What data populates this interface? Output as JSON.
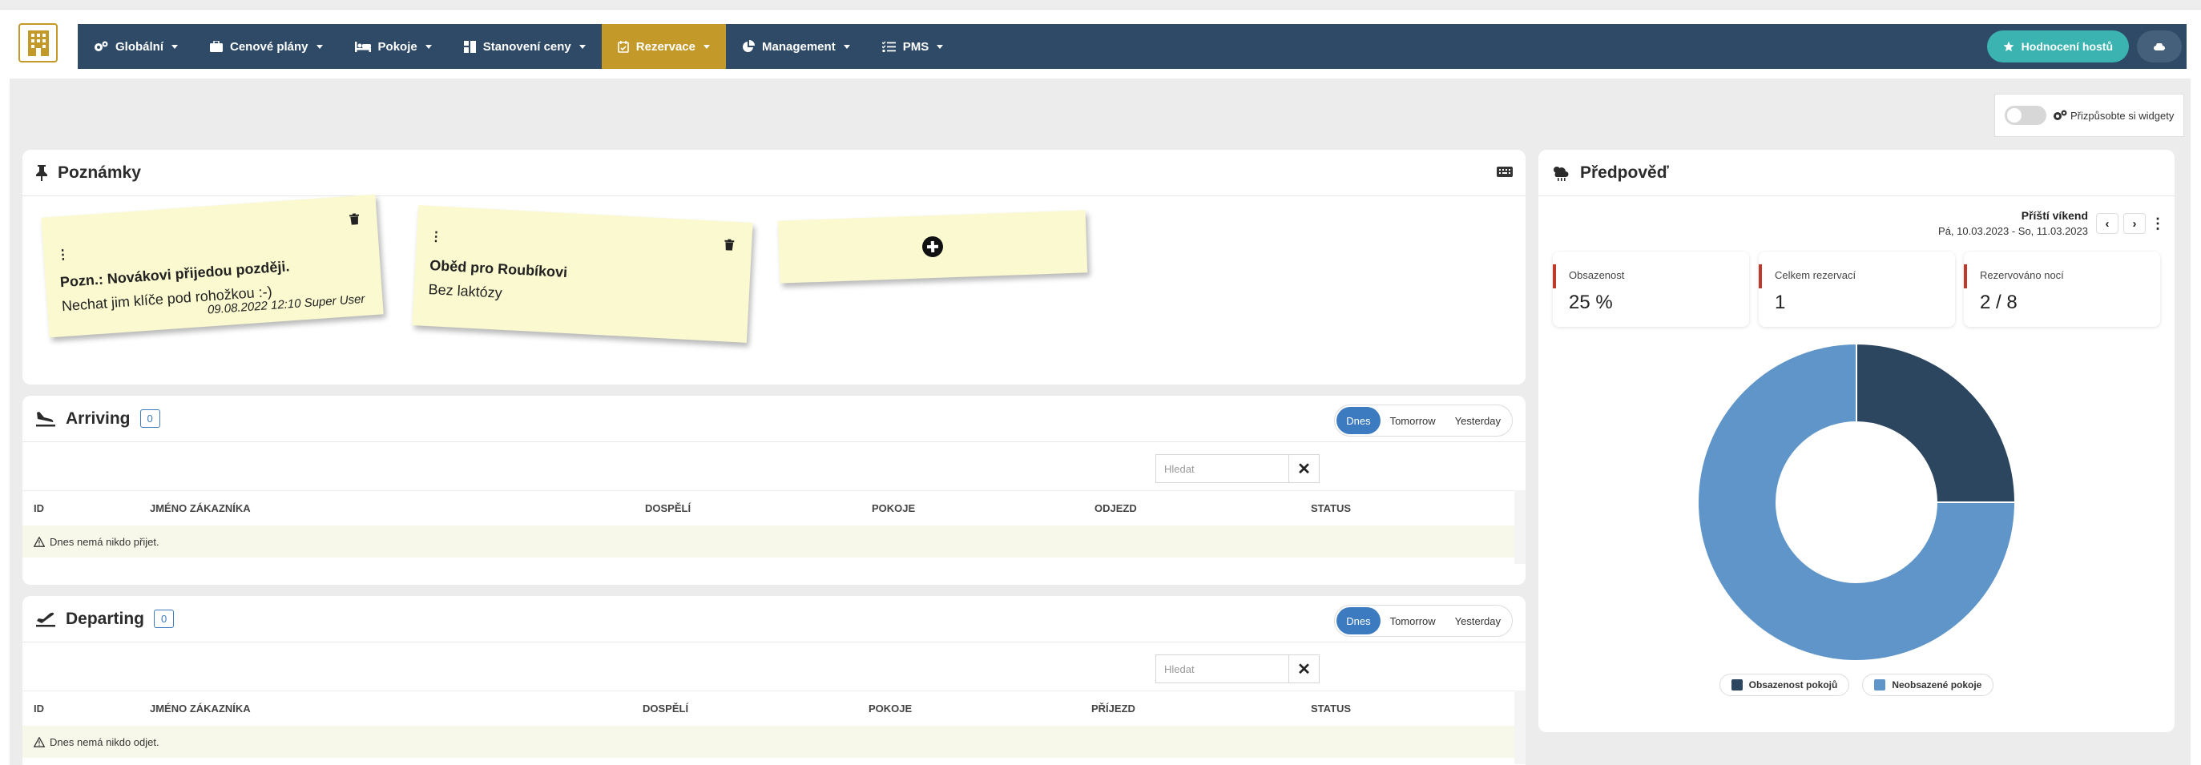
{
  "nav": {
    "items": [
      {
        "label": "Globální"
      },
      {
        "label": "Cenové plány"
      },
      {
        "label": "Pokoje"
      },
      {
        "label": "Stanovení ceny"
      },
      {
        "label": "Rezervace"
      },
      {
        "label": "Management"
      },
      {
        "label": "PMS"
      }
    ],
    "active_index": 4,
    "rating_label": "Hodnocení hostů"
  },
  "customize": {
    "label": "Přizpůsobte si widgety"
  },
  "notes": {
    "title": "Poznámky",
    "items": [
      {
        "line1": "Pozn.: Novákovi přijedou později.",
        "line2": "Nechat jim klíče pod rohožkou :-)",
        "signature": "09.08.2022 12:10 Super User"
      },
      {
        "line1": "Oběd pro Roubíkovi",
        "line2": "Bez laktózy"
      }
    ]
  },
  "arriving": {
    "title": "Arriving",
    "count": "0",
    "tabs": [
      "Dnes",
      "Tomorrow",
      "Yesterday"
    ],
    "search_placeholder": "Hledat",
    "columns": [
      "ID",
      "JMÉNO ZÁKAZNÍKA",
      "DOSPĚLÍ",
      "POKOJE",
      "ODJEZD",
      "STATUS"
    ],
    "empty": "Dnes nemá nikdo přijet."
  },
  "departing": {
    "title": "Departing",
    "count": "0",
    "tabs": [
      "Dnes",
      "Tomorrow",
      "Yesterday"
    ],
    "search_placeholder": "Hledat",
    "columns": [
      "ID",
      "JMÉNO ZÁKAZNÍKA",
      "DOSPĚLÍ",
      "POKOJE",
      "PŘÍJEZD",
      "STATUS"
    ],
    "empty": "Dnes nemá nikdo odjet."
  },
  "forecast": {
    "title": "Předpověď",
    "period_label": "Příští víkend",
    "period_dates": "Pá, 10.03.2023 - So, 11.03.2023",
    "stats": [
      {
        "label": "Obsazenost",
        "value": "25 %"
      },
      {
        "label": "Celkem rezervací",
        "value": "1"
      },
      {
        "label": "Rezervováno nocí",
        "value": "2 / 8"
      }
    ],
    "chart": {
      "type": "doughnut",
      "slices": [
        {
          "name": "Obsazenost pokojů",
          "value": 25,
          "color": "#2d4660"
        },
        {
          "name": "Neobsazené pokoje",
          "value": 75,
          "color": "#6095c9"
        }
      ]
    }
  },
  "colors": {
    "navbar": "#2e4a66",
    "active": "#c39a2a",
    "accent": "#3c7bbf",
    "rating": "#3bb3b0",
    "stat_marker": "#c0392b"
  }
}
